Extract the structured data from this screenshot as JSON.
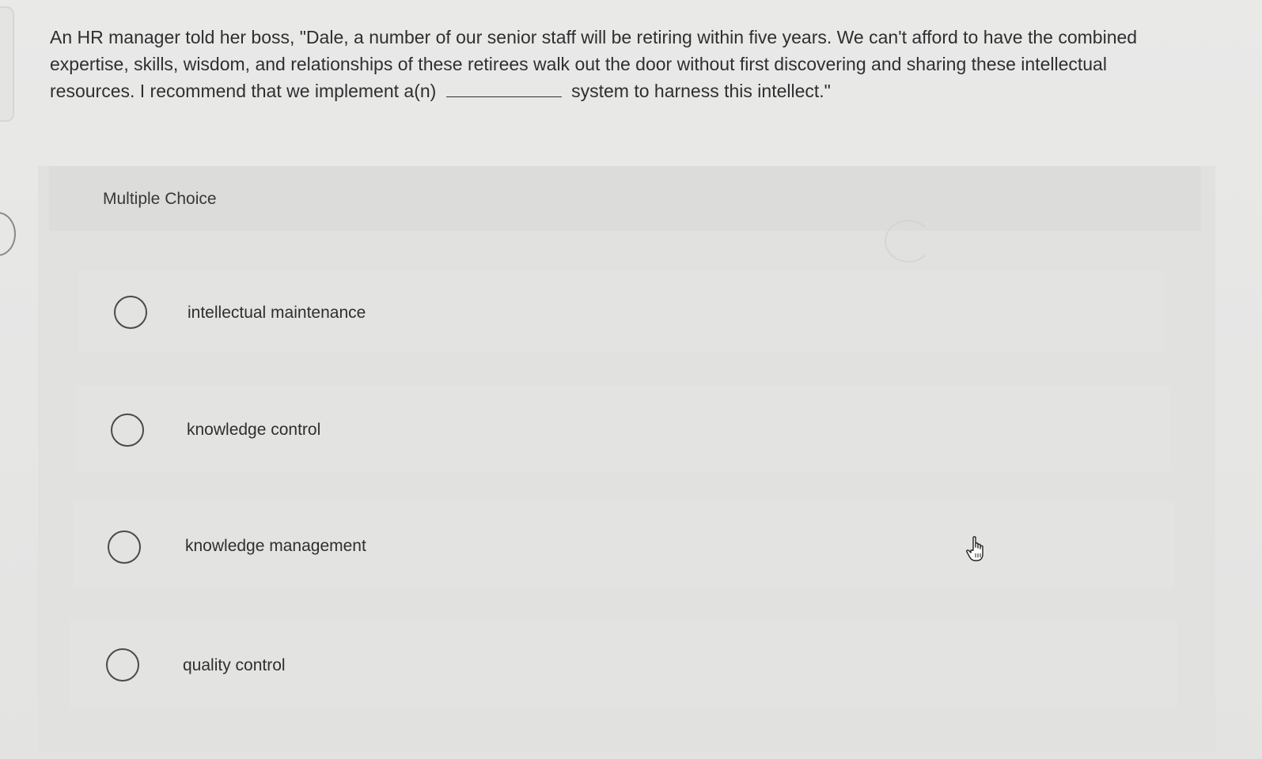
{
  "question": {
    "text_before": "An HR manager told her boss, \"Dale, a number of our senior staff will be retiring within five years. We can't afford to have the combined expertise, skills, wisdom, and relationships of these retirees walk out the door without first discovering and sharing these intellectual resources. I recommend that we implement a(n)",
    "text_after": "system to harness this intellect.\""
  },
  "multiple_choice": {
    "label": "Multiple Choice",
    "options": [
      {
        "label": "intellectual maintenance"
      },
      {
        "label": "knowledge control"
      },
      {
        "label": "knowledge management"
      },
      {
        "label": "quality control"
      }
    ]
  },
  "icons": {
    "radio": "radio-button-icon",
    "cursor": "hand-pointer-cursor-icon"
  }
}
